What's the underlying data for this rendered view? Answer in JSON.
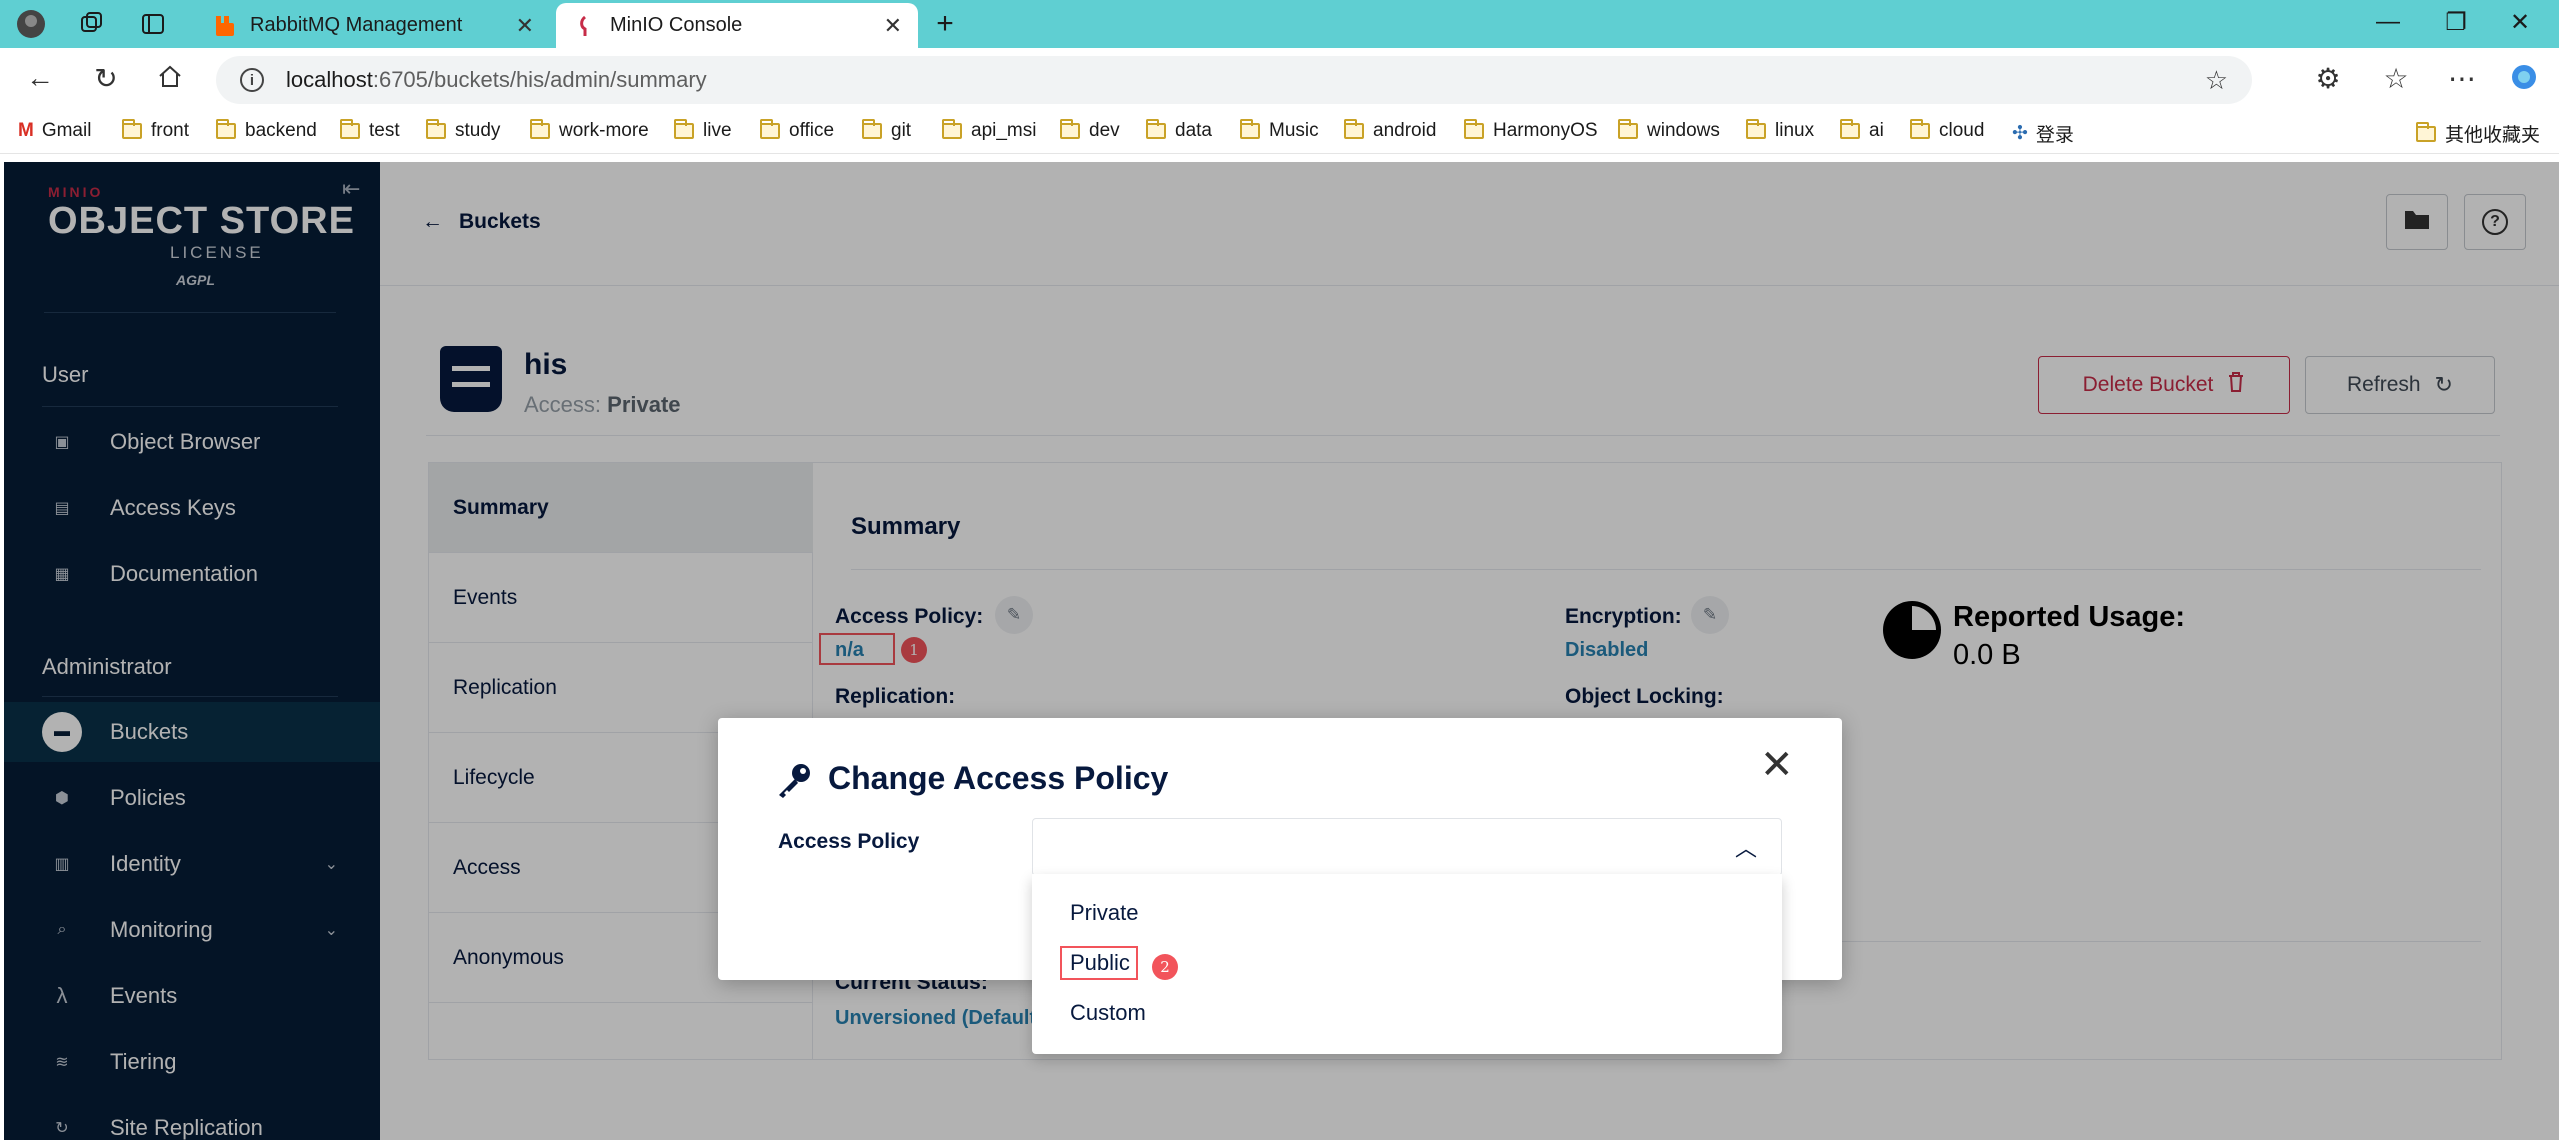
{
  "browser": {
    "tabs": [
      {
        "label": "RabbitMQ Management",
        "active": false
      },
      {
        "label": "MinIO Console",
        "active": true
      }
    ],
    "new_tab": "+",
    "address": {
      "host": "localhost",
      "path": ":6705/buckets/his/admin/summary"
    },
    "bookmarks": [
      "Gmail",
      "front",
      "backend",
      "test",
      "study",
      "work-more",
      "live",
      "office",
      "git",
      "api_msi",
      "dev",
      "data",
      "Music",
      "android",
      "HarmonyOS",
      "windows",
      "linux",
      "ai",
      "cloud",
      "登录"
    ],
    "other_bookmarks": "其他收藏夹"
  },
  "sidebar": {
    "logo": {
      "brand": "MINIO",
      "product": "OBJECT STORE",
      "badge": "AGPL",
      "license": "LICENSE"
    },
    "user_section": "User",
    "user_items": [
      {
        "label": "Object Browser",
        "icon": "object-browser-icon"
      },
      {
        "label": "Access Keys",
        "icon": "access-keys-icon"
      },
      {
        "label": "Documentation",
        "icon": "documentation-icon"
      }
    ],
    "admin_section": "Administrator",
    "admin_items": [
      {
        "label": "Buckets",
        "icon": "bucket-icon",
        "selected": true
      },
      {
        "label": "Policies",
        "icon": "policies-icon"
      },
      {
        "label": "Identity",
        "icon": "identity-icon",
        "expandable": true
      },
      {
        "label": "Monitoring",
        "icon": "monitoring-icon",
        "expandable": true
      },
      {
        "label": "Events",
        "icon": "lambda-icon"
      },
      {
        "label": "Tiering",
        "icon": "tiering-icon"
      },
      {
        "label": "Site Replication",
        "icon": "site-replication-icon"
      }
    ]
  },
  "page": {
    "back_label": "Buckets",
    "bucket_name": "his",
    "access_prefix": "Access:",
    "access_value": "Private",
    "delete_label": "Delete Bucket",
    "refresh_label": "Refresh",
    "tabs": [
      "Summary",
      "Events",
      "Replication",
      "Lifecycle",
      "Access",
      "Anonymous"
    ],
    "summary": {
      "title": "Summary",
      "access_policy_label": "Access Policy:",
      "access_policy_value": "n/a",
      "replication_label": "Replication:",
      "encryption_label": "Encryption:",
      "encryption_value": "Disabled",
      "object_locking_label": "Object Locking:",
      "usage_label": "Reported Usage:",
      "usage_value": "0.0 B",
      "current_status_label": "Current Status:",
      "current_status_value": "Unversioned (Default)"
    }
  },
  "annotations": [
    "1",
    "2"
  ],
  "modal": {
    "title": "Change Access Policy",
    "field_label": "Access Policy",
    "selected_value": "",
    "options": [
      "Private",
      "Public",
      "Custom"
    ]
  },
  "colors": {
    "accent": "#2781b0",
    "danger": "#c72c48",
    "sidebar": "#071d37",
    "annotation": "#f2545b",
    "tabbar": "#5fcfd2"
  }
}
